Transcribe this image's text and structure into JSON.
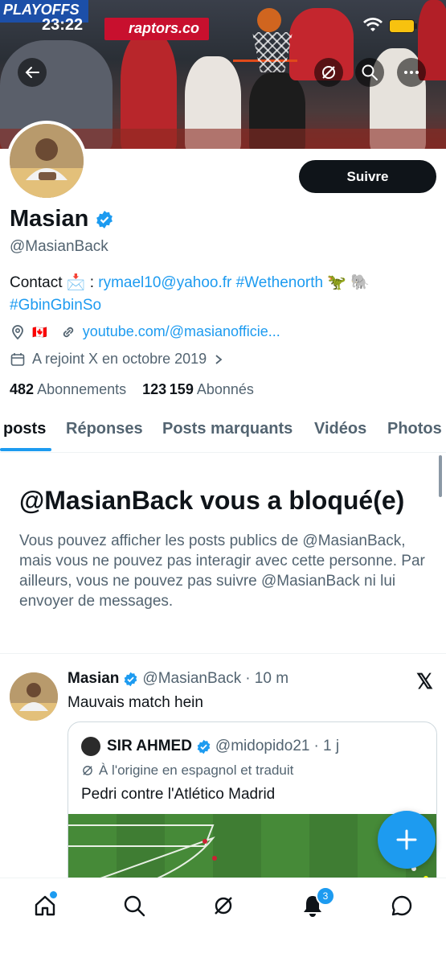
{
  "status_bar": {
    "time": "23:22"
  },
  "banner": {
    "ad_text_1": "PLAYOFFS",
    "ad_text_2": "raptors.co"
  },
  "profile": {
    "name": "Masian",
    "handle": "@MasianBack",
    "follow_label": "Suivre",
    "bio": {
      "prefix": "Contact 📩 : ",
      "email": "rymael10@yahoo.fr",
      "hashtag1": "#Wethenorth",
      "emoji": " 🦖  🐘",
      "hashtag2": "#GbinGbinSo"
    },
    "location_flag": "🇨🇦",
    "website": "youtube.com/@masianofficie...",
    "joined": "A rejoint X en octobre 2019",
    "following_count": "482",
    "following_label": "Abonnements",
    "followers_count": "123 159",
    "followers_label": "Abonnés"
  },
  "tabs": [
    {
      "label": "posts"
    },
    {
      "label": "Réponses"
    },
    {
      "label": "Posts marquants"
    },
    {
      "label": "Vidéos"
    },
    {
      "label": "Photos"
    }
  ],
  "blocked": {
    "title": "@MasianBack vous a bloqué(e)",
    "body": "Vous pouvez afficher les posts publics de @MasianBack, mais vous ne pouvez pas interagir avec cette personne. Par ailleurs, vous ne pouvez pas suivre @MasianBack ni lui envoyer de messages."
  },
  "post": {
    "name": "Masian",
    "handle": "@MasianBack",
    "time": "· 10 m",
    "text": "Mauvais match hein",
    "quote": {
      "name": "SIR AHMED",
      "handle": "@midopido21",
      "time": "· 1 j",
      "translation_note": "À l'origine en espagnol et traduit",
      "text": "Pedri contre l'Atlético Madrid"
    }
  },
  "bottom_nav": {
    "notifications_badge": "3"
  },
  "colors": {
    "accent": "#1d9bf0",
    "text": "#0f1419",
    "secondary": "#536471"
  }
}
